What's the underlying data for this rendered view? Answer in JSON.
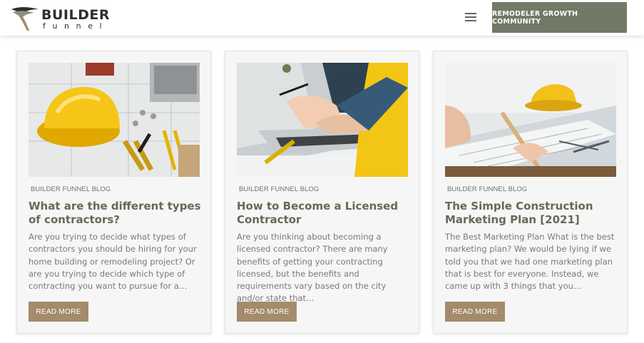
{
  "header": {
    "logo_word": "BUILDER",
    "logo_sub": "funnel",
    "cta_label": "REMODELER GROWTH COMMUNITY"
  },
  "colors": {
    "accent_olive": "#717a66",
    "title_green": "#636b55",
    "button_tan": "#a48b6a"
  },
  "posts": [
    {
      "category": "BUILDER FUNNEL BLOG",
      "title": "What are the different types of contractors?",
      "excerpt": "Are you trying to decide what types of contractors you should be hiring for your home building or remodeling project? Or are you trying to decide which type of contracting you want to pursue for a…",
      "button": "READ MORE",
      "image_icon": "hard-hat-blueprint-image"
    },
    {
      "category": "BUILDER FUNNEL BLOG",
      "title": "How to Become a Licensed Contractor",
      "excerpt": "Are you thinking about becoming a licensed contractor? There are many benefits of getting your contracting licensed, but the benefits and requirements vary based on the city and/or state that…",
      "button": "READ MORE",
      "image_icon": "laptop-typing-image"
    },
    {
      "category": "BUILDER FUNNEL BLOG",
      "title": "The Simple Construction Marketing Plan [2021]",
      "excerpt": "The Best Marketing Plan What is the best marketing plan? We would be lying if we told you that we had one marketing plan that is best for everyone. Instead, we came up with 3 things that you…",
      "button": "READ MORE",
      "image_icon": "drafting-plans-image"
    }
  ]
}
